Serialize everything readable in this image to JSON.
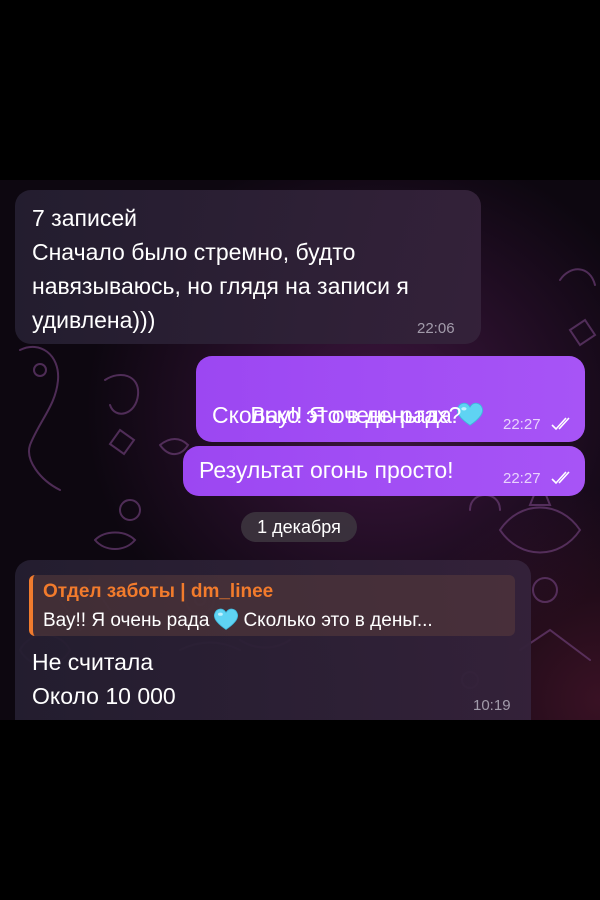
{
  "messages": [
    {
      "id": "m1",
      "direction": "incoming",
      "lines": [
        "7 записей",
        "Сначало было стремно, будто",
        "навязываюсь, но глядя на записи я",
        "удивлена)))"
      ],
      "time": "22:06"
    },
    {
      "id": "m2",
      "direction": "outgoing",
      "line1": "Вау!! Я очень рада",
      "line1_emoji": "light-blue-heart",
      "line2": "Сколько это в деньгах?",
      "time": "22:27",
      "status": "read"
    },
    {
      "id": "m3",
      "direction": "outgoing",
      "line1": "Результат огонь просто!",
      "time": "22:27",
      "status": "read"
    }
  ],
  "date_separator": "1 декабря",
  "reply_message": {
    "quote_author": "Отдел заботы | dm_linee",
    "quote_text_start": "Вау!! Я очень рада",
    "quote_emoji": "light-blue-heart",
    "quote_text_end": "Сколько это в деньг...",
    "lines": [
      "Не считала",
      "Около 10 000"
    ],
    "time": "10:19"
  },
  "colors": {
    "outgoing_bubble": "#a050f4",
    "incoming_bubble": "#2a2236",
    "reply_author": "#f27b2c",
    "heart": "#5fd3f3"
  }
}
